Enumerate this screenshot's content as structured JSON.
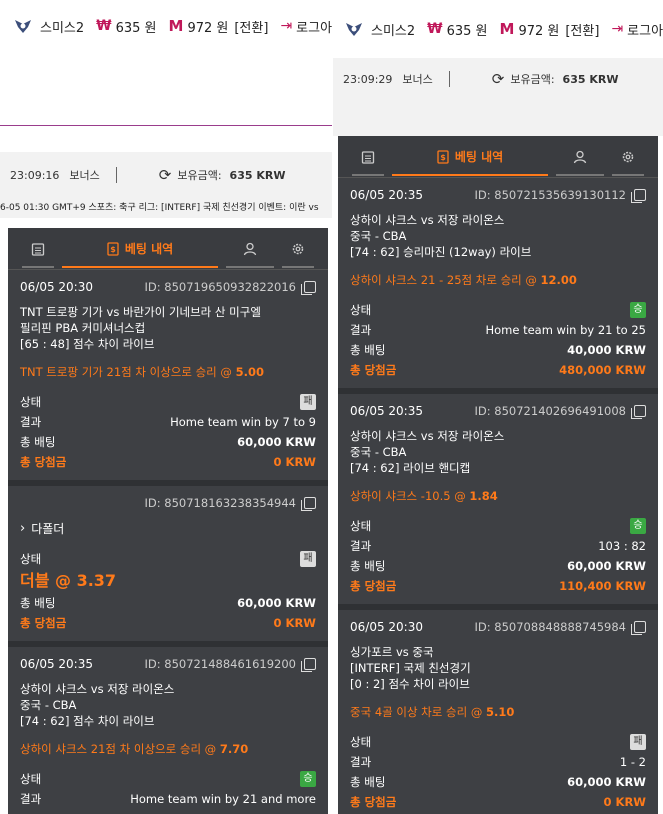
{
  "left": {
    "topnav": {
      "username": "스미스2",
      "w_amount": "635 원",
      "w_symbol": "₩",
      "m_symbol": "M",
      "m_amount": "972 원",
      "convert": "[전환]",
      "logout": "로그아"
    },
    "info": {
      "time": "23:09:16",
      "bonus": "보너스",
      "balance_label": "보유금액:",
      "balance_value": "635 KRW"
    },
    "ticker": "6-05 01:30 GMT+9 스포츠: 축구 리그: [INTERF] 국제 친선경기 이벤트: 이란 vs",
    "tabs": {
      "active_label": "베팅 내역"
    },
    "cards": [
      {
        "date": "06/05 20:30",
        "id": "ID: 850719650932822016",
        "match": [
          "TNT 트로팡 기가 vs 바란가이 기네브라 산 미구엘",
          "필리핀 PBA 커미셔너스컵",
          "[65 : 48] 점수 차이 라이브"
        ],
        "pick": "TNT 트로팡 기가 21점 차 이상으로 승리 @",
        "odds": "5.00",
        "status_label": "상태",
        "status_badge": "패",
        "result_label": "결과",
        "result_value": "Home team win by 7 to 9",
        "stake_label": "총 배팅",
        "stake_value": "60,000 KRW",
        "win_label": "총 당첨금",
        "win_value": "0 KRW"
      },
      {
        "id": "ID: 850718163238354944",
        "parlay_label": "다폴더",
        "status_label": "상태",
        "status_badge": "패",
        "odds_label": "더블 @ 3.37",
        "stake_label": "총 배팅",
        "stake_value": "60,000 KRW",
        "win_label": "총 당첨금",
        "win_value": "0 KRW"
      },
      {
        "date": "06/05 20:35",
        "id": "ID: 850721488461619200",
        "match": [
          "상하이 샤크스 vs 저장 라이온스",
          "중국 - CBA",
          "[74 : 62] 점수 차이 라이브"
        ],
        "pick": "상하이 샤크스 21점 차 이상으로 승리 @",
        "odds": "7.70",
        "status_label": "상태",
        "status_badge": "승",
        "result_label": "결과",
        "result_value": "Home team win by 21 and more"
      }
    ]
  },
  "right": {
    "topnav": {
      "username": "스미스2",
      "w_amount": "635 원",
      "w_symbol": "₩",
      "m_symbol": "M",
      "m_amount": "972 원",
      "convert": "[전환]",
      "logout": "로그아"
    },
    "info": {
      "time": "23:09:29",
      "bonus": "보너스",
      "balance_label": "보유금액:",
      "balance_value": "635 KRW"
    },
    "tabs": {
      "active_label": "베팅 내역"
    },
    "cards": [
      {
        "date": "06/05 20:35",
        "id": "ID: 850721535639130112",
        "match": [
          "상하이 샤크스 vs 저장 라이온스",
          "중국 - CBA",
          "[74 : 62] 승리마진 (12way) 라이브"
        ],
        "pick": "상하이 샤크스 21 - 25점 차로 승리 @",
        "odds": "12.00",
        "status_label": "상태",
        "status_badge": "승",
        "result_label": "결과",
        "result_value": "Home team win by 21 to 25",
        "stake_label": "총 배팅",
        "stake_value": "40,000 KRW",
        "win_label": "총 당첨금",
        "win_value": "480,000 KRW"
      },
      {
        "date": "06/05 20:35",
        "id": "ID: 850721402696491008",
        "match": [
          "상하이 샤크스 vs 저장 라이온스",
          "중국 - CBA",
          "[74 : 62] 라이브 핸디캡"
        ],
        "pick": "상하이 샤크스 -10.5 @",
        "odds": "1.84",
        "status_label": "상태",
        "status_badge": "승",
        "result_label": "결과",
        "result_value": "103 : 82",
        "stake_label": "총 배팅",
        "stake_value": "60,000 KRW",
        "win_label": "총 당첨금",
        "win_value": "110,400 KRW"
      },
      {
        "date": "06/05 20:30",
        "id": "ID: 850708848888745984",
        "match": [
          "싱가포르 vs 중국",
          "[INTERF] 국제 친선경기",
          "[0 : 2] 점수 차이 라이브"
        ],
        "pick": "중국 4골 이상 차로 승리 @",
        "odds": "5.10",
        "status_label": "상태",
        "status_badge": "패",
        "result_label": "결과",
        "result_value": "1 - 2",
        "stake_label": "총 배팅",
        "stake_value": "60,000 KRW",
        "win_label": "총 당첨금",
        "win_value": "0 KRW"
      }
    ]
  },
  "colors": {
    "accent": "#ff7a1a",
    "brand": "#c0185a",
    "panel_bg": "#3a3c40",
    "win_badge": "#3aa843"
  },
  "icons": {
    "logo": "eagle-logo-icon",
    "logout": "logout-icon",
    "refresh": "refresh-icon",
    "calendar": "calendar-icon",
    "receipt": "receipt-icon",
    "user": "user-icon",
    "gear": "gear-icon",
    "copy": "copy-icon",
    "chevron": "chevron-right-icon"
  }
}
